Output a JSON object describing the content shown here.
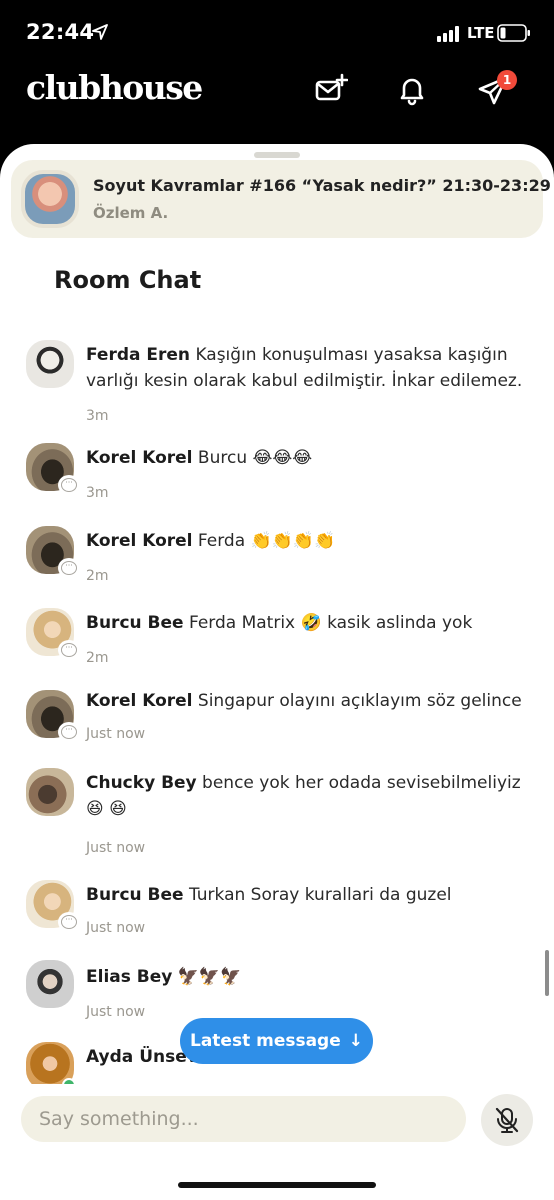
{
  "status": {
    "time": "22:44",
    "network": "LTE"
  },
  "header": {
    "logo": "clubhouse",
    "notifications_badge": "1"
  },
  "room": {
    "title": "Soyut Kavramlar #166 “Yasak nedir?” 21:30-23:29",
    "host": "Özlem A."
  },
  "chat": {
    "heading": "Room Chat",
    "messages": [
      {
        "name": "Ferda Eren",
        "text": "Kaşığın konuşulması yasaksa kaşığın varlığı kesin olarak kabul edilmiştir. İnkar edilemez.",
        "time": "3m"
      },
      {
        "name": "Korel Korel",
        "text": "Burcu 😂😂😂",
        "time": "3m"
      },
      {
        "name": "Korel Korel",
        "text": "Ferda 👏👏👏👏",
        "time": "2m"
      },
      {
        "name": "Burcu Bee",
        "text": "Ferda Matrix 🤣 kasik aslinda yok",
        "time": "2m"
      },
      {
        "name": "Korel Korel",
        "text": "Singapur olayını açıklayım söz gelince",
        "time": "Just now"
      },
      {
        "name": "Chucky Bey",
        "text": "bence yok her odada sevisebilmeliyiz😆 😆",
        "time": "Just now"
      },
      {
        "name": "Burcu Bee",
        "text": "Turkan Soray kurallari da guzel",
        "time": "Just now"
      },
      {
        "name": "Elias Bey",
        "text": "🦅🦅🦅",
        "time": "Just now"
      },
      {
        "name": "Ayda Ünsev",
        "text": "",
        "time": ""
      }
    ]
  },
  "latest_message_label": "Latest message",
  "latest_message_arrow": "↓",
  "compose": {
    "placeholder": "Say something..."
  }
}
